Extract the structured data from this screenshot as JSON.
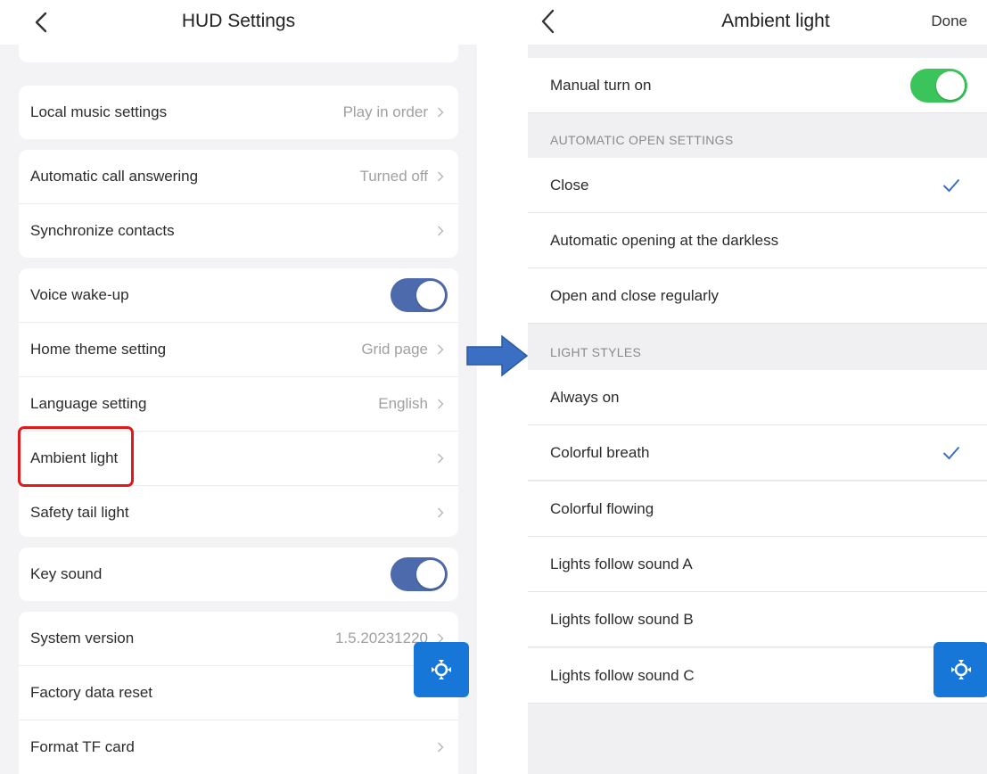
{
  "left": {
    "title": "HUD Settings",
    "rows": {
      "local_music": {
        "label": "Local music settings",
        "value": "Play in order"
      },
      "call_answer": {
        "label": "Automatic call answering",
        "value": "Turned off"
      },
      "sync_contacts": {
        "label": "Synchronize contacts"
      },
      "voice_wakeup": {
        "label": "Voice wake-up",
        "on": true
      },
      "home_theme": {
        "label": "Home theme setting",
        "value": "Grid page"
      },
      "language": {
        "label": "Language setting",
        "value": "English"
      },
      "ambient": {
        "label": "Ambient light"
      },
      "tail_light": {
        "label": "Safety tail light"
      },
      "key_sound": {
        "label": "Key sound",
        "on": true
      },
      "system_version": {
        "label": "System version",
        "value": "1.5.20231220"
      },
      "factory_reset": {
        "label": "Factory data reset"
      },
      "format_tf": {
        "label": "Format TF card"
      }
    }
  },
  "right": {
    "title": "Ambient light",
    "done_label": "Done",
    "manual": {
      "label": "Manual turn on",
      "on": true
    },
    "auto_section": "AUTOMATIC OPEN SETTINGS",
    "auto_options": [
      {
        "label": "Close",
        "checked": true
      },
      {
        "label": "Automatic opening at the darkless",
        "checked": false
      },
      {
        "label": "Open and close regularly",
        "checked": false
      }
    ],
    "styles_section": "LIGHT STYLES",
    "style_options": [
      {
        "label": "Always on",
        "checked": false
      },
      {
        "label": "Colorful breath",
        "checked": true
      },
      {
        "label": "Colorful flowing",
        "checked": false
      },
      {
        "label": "Lights follow sound A",
        "checked": false
      },
      {
        "label": "Lights follow sound B",
        "checked": false
      },
      {
        "label": "Lights follow sound C",
        "checked": false
      }
    ]
  },
  "colors": {
    "left_toggle": "#4d6aad",
    "right_toggle": "#3bc45a",
    "accent_blue": "#1677d8",
    "check_blue": "#3d6fc4",
    "highlight_red": "#e0191c"
  },
  "icons": {
    "back": "chevron-left-icon",
    "row_chevron": "chevron-right-icon",
    "check": "checkmark-icon",
    "float": "assistive-touch-icon",
    "transition": "arrow-right-icon"
  }
}
